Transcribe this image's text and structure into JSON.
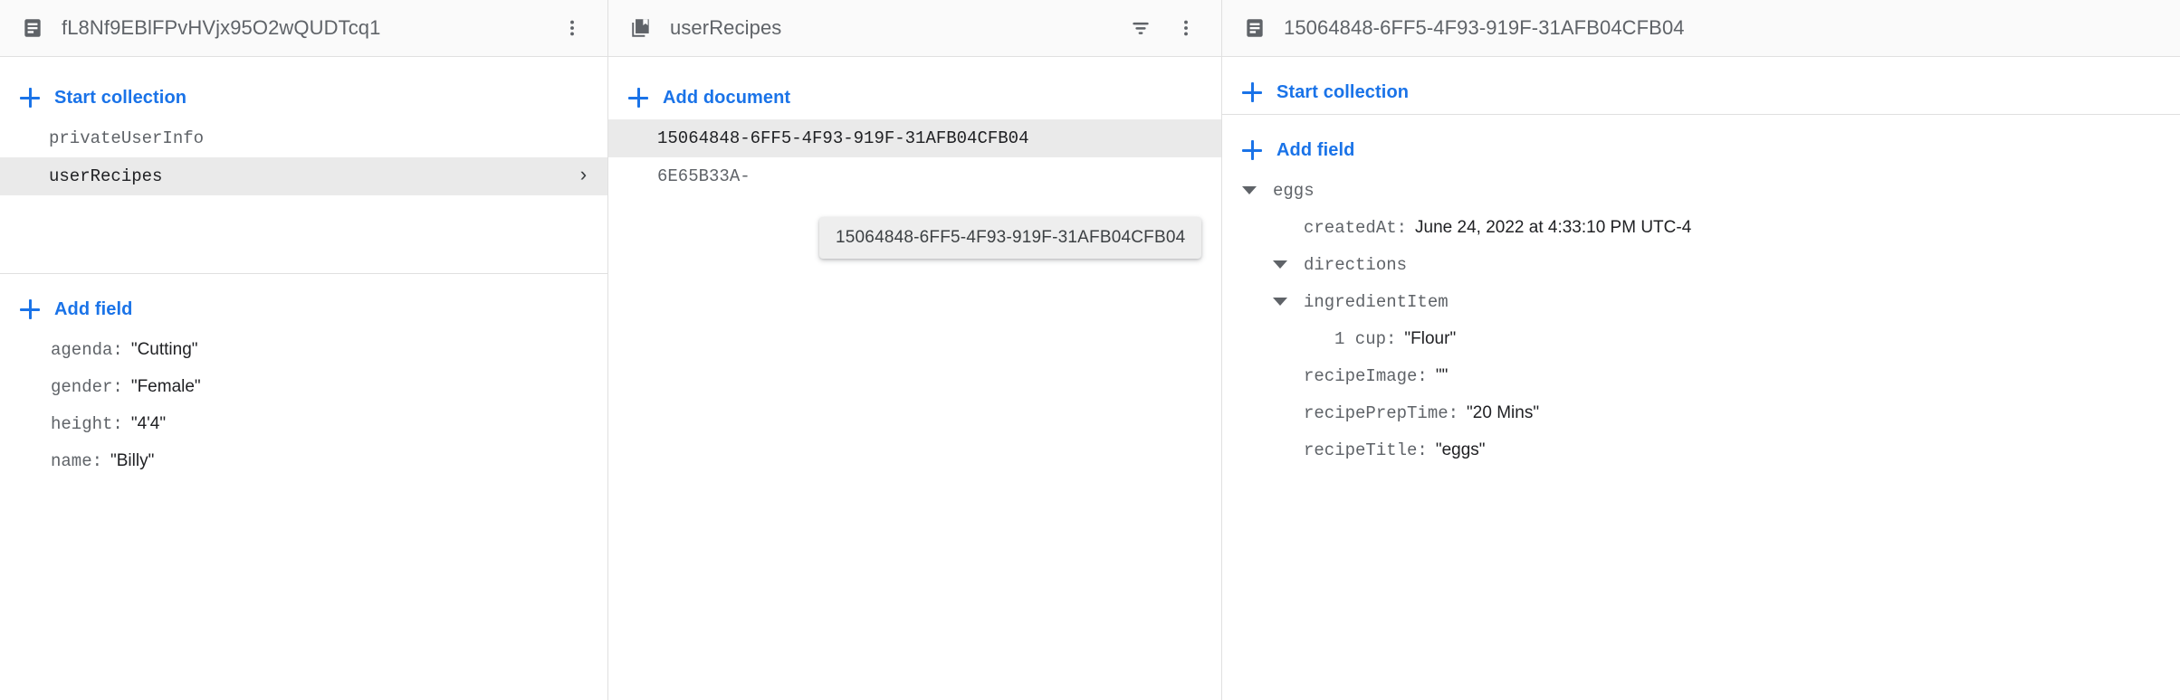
{
  "app": "firebase-firestore-data-browser",
  "colors": {
    "accent": "#1a73e8",
    "selected_row_bg": "#eaeaea",
    "header_bg": "#fafafa",
    "border": "#e0e0e0",
    "key_text": "#5f6368",
    "value_text": "#202124",
    "tooltip_bg": "#eeeeee"
  },
  "panels": {
    "document_panel": {
      "icon": "document-icon",
      "title": "fL8Nf9EBlFPvHVjx95O2wQUDTcq1",
      "more_menu_icon": "more-vert-icon",
      "start_collection_label": "Start collection",
      "collections": [
        {
          "name": "privateUserInfo",
          "selected": false
        },
        {
          "name": "userRecipes",
          "selected": true,
          "chevron": "chevron-right-icon"
        }
      ],
      "add_field_label": "Add field",
      "fields": [
        {
          "key": "agenda",
          "value": "\"Cutting\""
        },
        {
          "key": "gender",
          "value": "\"Female\""
        },
        {
          "key": "height",
          "value": "\"4'4\""
        },
        {
          "key": "name",
          "value": "\"Billy\""
        }
      ]
    },
    "collection_panel": {
      "icon": "collection-icon",
      "title": "userRecipes",
      "filter_icon": "filter-icon",
      "more_menu_icon": "more-vert-icon",
      "add_document_label": "Add document",
      "documents": [
        {
          "id": "15064848-6FF5-4F93-919F-31AFB04CFB04",
          "selected": true
        },
        {
          "id": "6E65B33A-",
          "selected": false
        }
      ],
      "tooltip": {
        "text": "15064848-6FF5-4F93-919F-31AFB04CFB04"
      }
    },
    "detail_panel": {
      "icon": "document-icon",
      "title": "15064848-6FF5-4F93-919F-31AFB04CFB04",
      "start_collection_label": "Start collection",
      "add_field_label": "Add field",
      "fields": [
        {
          "kind": "map",
          "caret": "caret-down-icon",
          "indent": 1,
          "key": "eggs"
        },
        {
          "kind": "value",
          "indent": 2,
          "key": "createdAt",
          "value": "June 24, 2022 at 4:33:10 PM UTC-4"
        },
        {
          "kind": "map",
          "caret": "caret-down-icon",
          "indent": 2,
          "key": "directions"
        },
        {
          "kind": "map",
          "caret": "caret-down-icon",
          "indent": 2,
          "key": "ingredientItem"
        },
        {
          "kind": "value",
          "indent": 3,
          "key": "1 cup",
          "value": "\"Flour\""
        },
        {
          "kind": "value",
          "indent": 2,
          "key": "recipeImage",
          "value": "\"\""
        },
        {
          "kind": "value",
          "indent": 2,
          "key": "recipePrepTime",
          "value": "\"20 Mins\""
        },
        {
          "kind": "value",
          "indent": 2,
          "key": "recipeTitle",
          "value": "\"eggs\""
        }
      ]
    }
  }
}
